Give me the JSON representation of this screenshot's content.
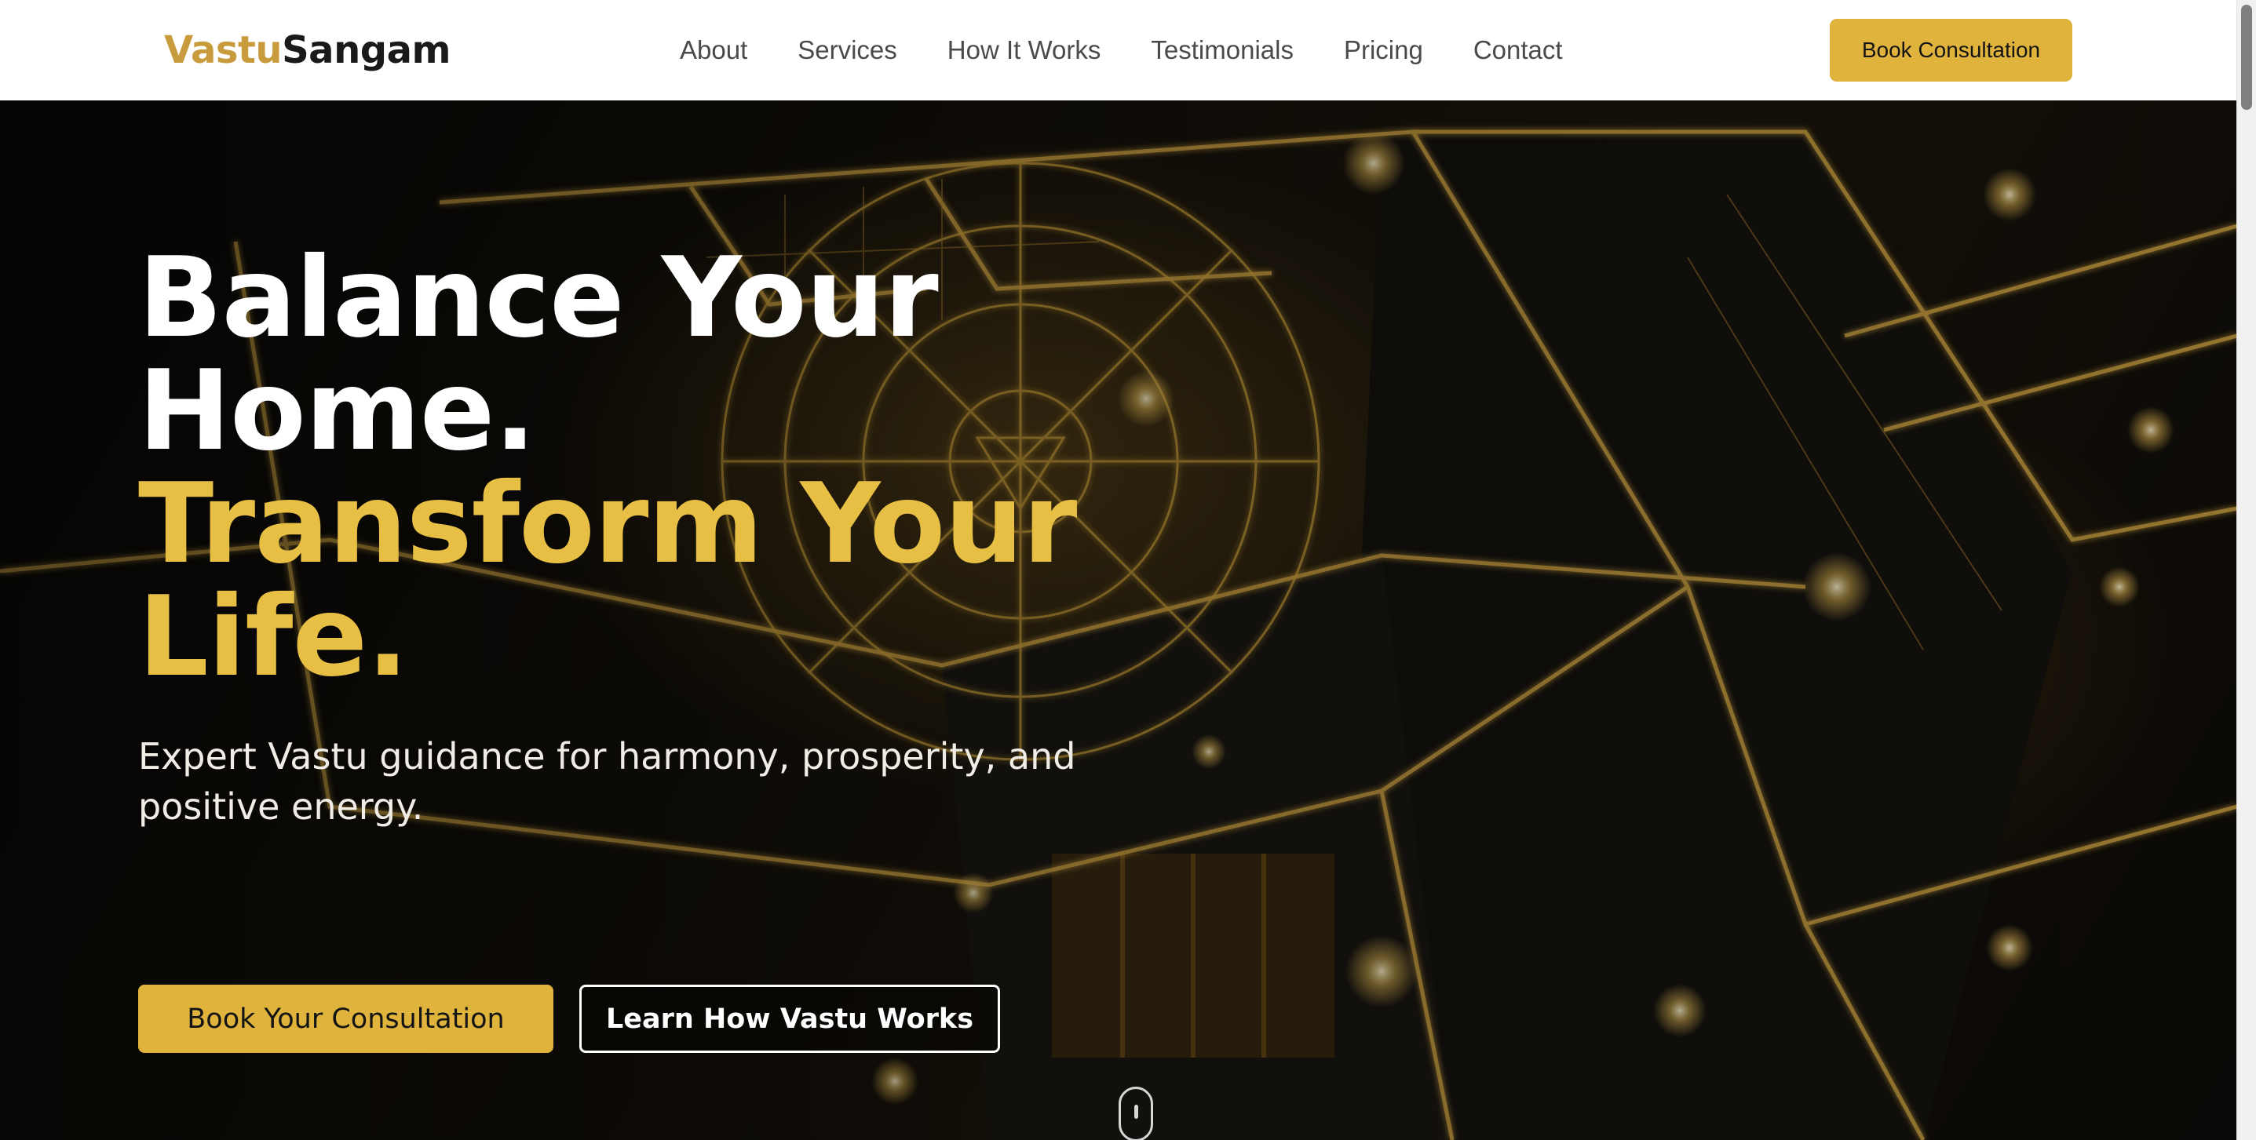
{
  "brand": {
    "part1": "Vastu",
    "part2": "Sangam"
  },
  "nav": {
    "links": [
      {
        "label": "About"
      },
      {
        "label": "Services"
      },
      {
        "label": "How It Works"
      },
      {
        "label": "Testimonials"
      },
      {
        "label": "Pricing"
      },
      {
        "label": "Contact"
      }
    ],
    "cta_label": "Book Consultation"
  },
  "hero": {
    "headline_white_1": "Balance Your",
    "headline_white_2": "Home.",
    "headline_gold_1": "Transform Your",
    "headline_gold_2": "Life.",
    "subtitle": "Expert Vastu guidance for harmony, prosperity, and positive energy.",
    "primary_button": "Book Your Consultation",
    "secondary_button": "Learn How Vastu Works"
  },
  "icons": {
    "scroll_indicator": "mouse-scroll-icon"
  },
  "colors": {
    "accent_gold": "#e0b43c",
    "headline_gold": "#e8bf45",
    "brand_gold": "#c89b3c"
  }
}
